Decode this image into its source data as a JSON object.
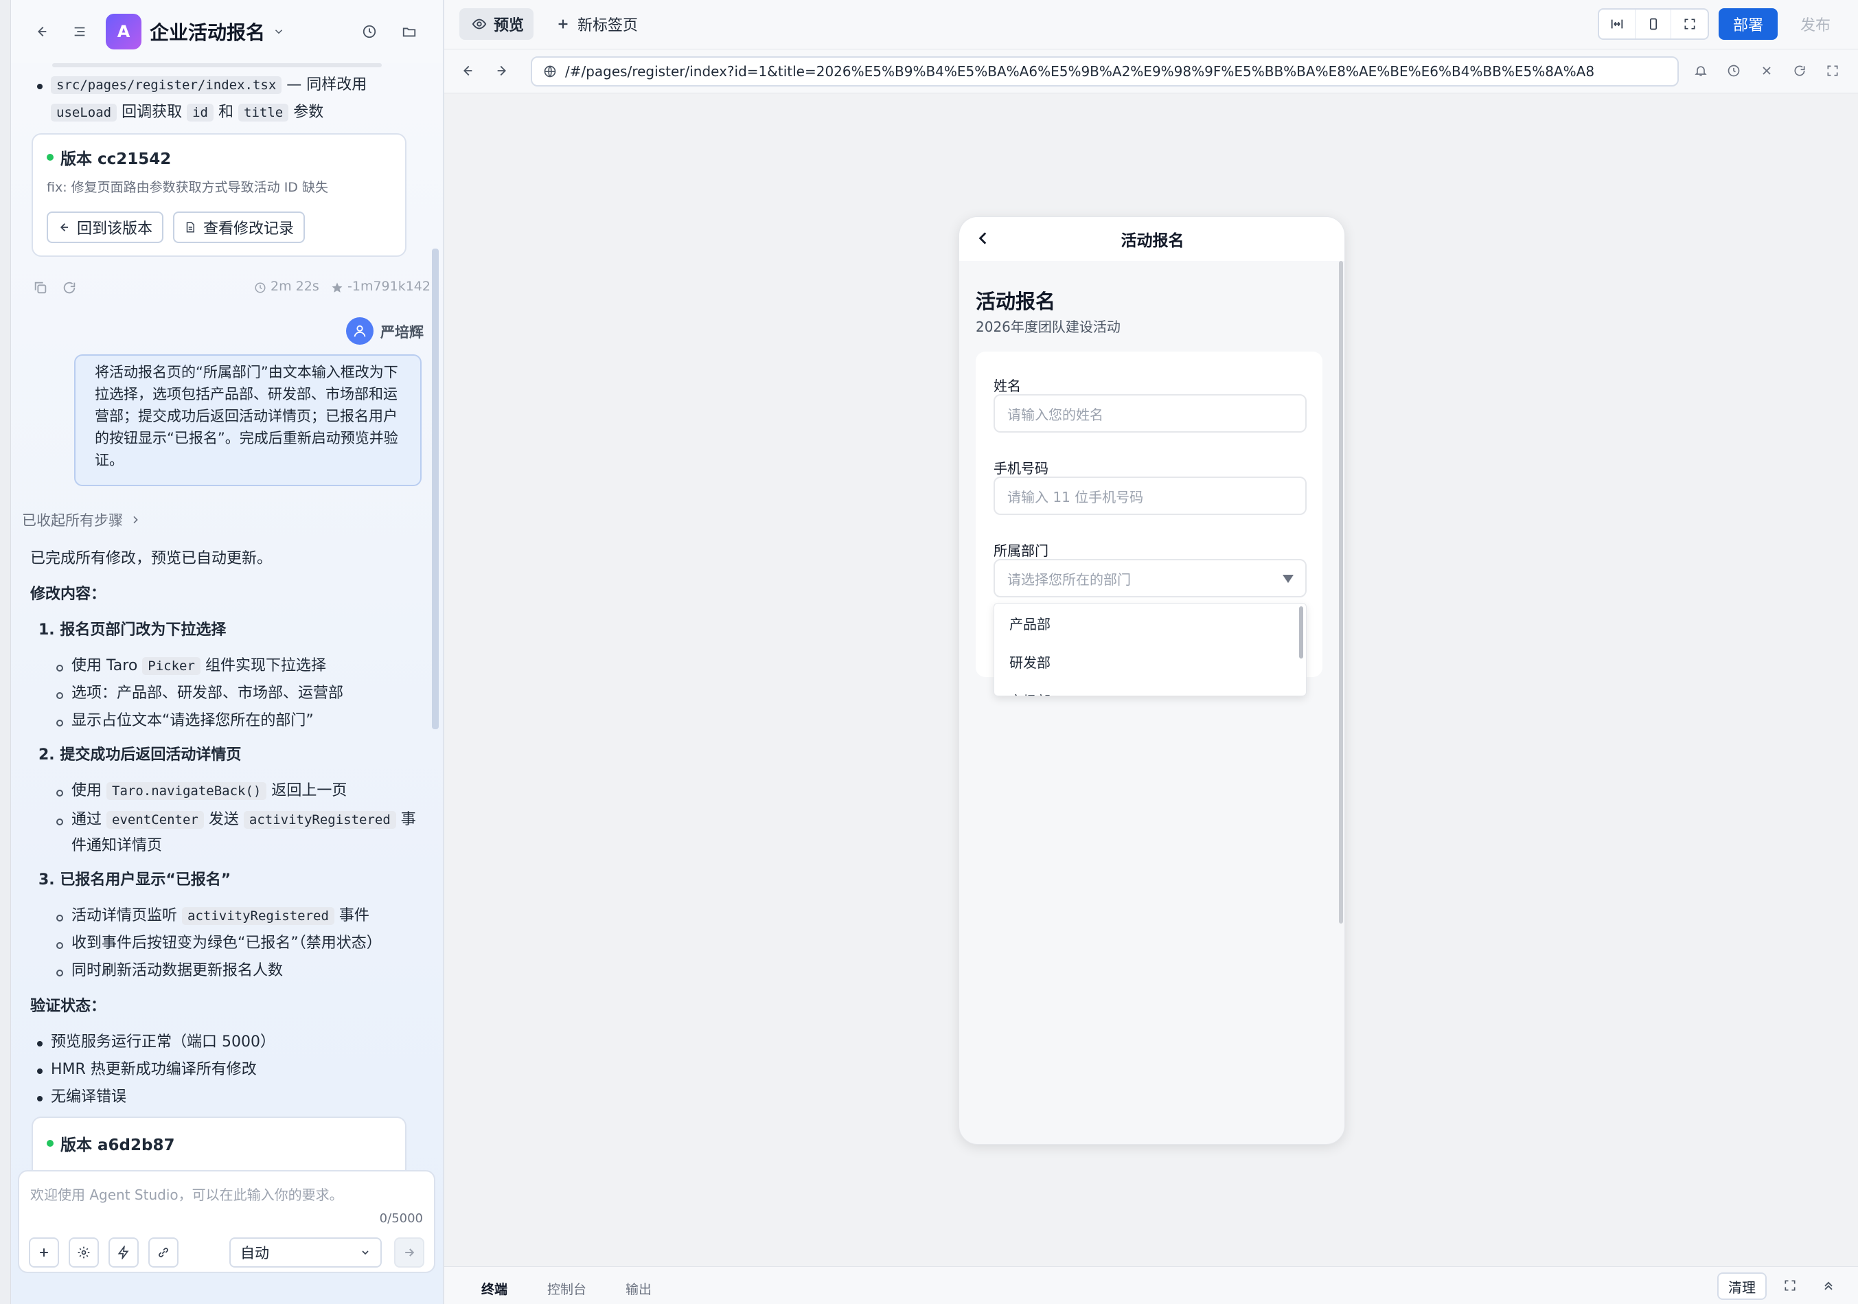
{
  "app": {
    "avatar_letter": "A",
    "title": "企业活动报名",
    "accent": "#1a66e0"
  },
  "chat": {
    "top_item": {
      "file": "src/pages/register/index.tsx",
      "tail": " — 同样改用",
      "code1": "useLoad",
      "t1": "回调获取",
      "code2": "id",
      "t2": "和",
      "code3": "title",
      "t3": "参数"
    },
    "version1": {
      "label": "版本 cc21542",
      "msg": "fix: 修复页面路由参数获取方式导致活动 ID 缺失",
      "restore": "回到该版本",
      "view": "查看修改记录"
    },
    "meta": {
      "duration": "2m 22s",
      "tokens": "-1m791k142"
    },
    "user": {
      "name": "严培辉",
      "message": "将活动报名页的“所属部门”由文本输入框改为下拉选择，选项包括产品部、研发部、市场部和运营部；提交成功后返回活动详情页；已报名用户的按钮显示“已报名”。完成后重新启动预览并验证。"
    },
    "collapsed": "已收起所有步骤",
    "done": "已完成所有修改，预览已自动更新。",
    "mod_title": "修改内容：",
    "sec1": {
      "title": "1. 报名页部门改为下拉选择",
      "b1a": "使用 Taro",
      "b1code": "Picker",
      "b1b": "组件实现下拉选择",
      "b2": "选项：产品部、研发部、市场部、运营部",
      "b3": "显示占位文本“请选择您所在的部门”"
    },
    "sec2": {
      "title": "2. 提交成功后返回活动详情页",
      "b1a": "使用",
      "b1code": "Taro.navigateBack()",
      "b1b": "返回上一页",
      "b2a": "通过",
      "b2code1": "eventCenter",
      "b2b": "发送",
      "b2code2": "activityRegistered",
      "b2c": "事",
      "b2d": "件通知详情页"
    },
    "sec3": {
      "title": "3. 已报名用户显示“已报名”",
      "b1a": "活动详情页监听",
      "b1code": "activityRegistered",
      "b1b": "事件",
      "b2": "收到事件后按钮变为绿色“已报名”（禁用状态）",
      "b3": "同时刷新活动数据更新报名人数"
    },
    "verify_title": "验证状态：",
    "verify": [
      "预览服务运行正常（端口 5000）",
      "HMR 热更新成功编译所有修改",
      "无编译错误"
    ],
    "version2": {
      "label": "版本 a6d2b87"
    }
  },
  "input": {
    "placeholder": "欢迎使用 Agent Studio，可以在此输入你的要求。",
    "counter": "0/5000",
    "mode": "自动"
  },
  "tabs": {
    "preview": "预览",
    "new_tab": "新标签页",
    "deploy": "部署",
    "publish": "发布"
  },
  "url": "/#/pages/register/index?id=1&title=2026%E5%B9%B4%E5%BA%A6%E5%9B%A2%E9%98%9F%E5%BB%BA%E8%AE%BE%E6%B4%BB%E5%8A%A8",
  "phone": {
    "nav_title": "活动报名",
    "page_title": "活动报名",
    "subtitle": "2026年度团队建设活动",
    "name_label": "姓名",
    "name_ph": "请输入您的姓名",
    "phone_label": "手机号码",
    "phone_ph": "请输入 11 位手机号码",
    "dept_label": "所属部门",
    "dept_ph": "请选择您所在的部门",
    "options": [
      "产品部",
      "研发部",
      "市场部"
    ]
  },
  "bottom": {
    "terminal": "终端",
    "console": "控制台",
    "output": "输出",
    "clear": "清理"
  }
}
